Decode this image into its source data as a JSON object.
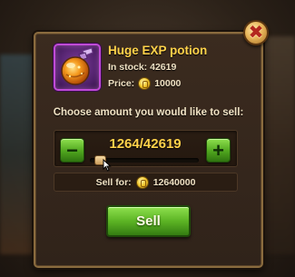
{
  "item": {
    "name": "Huge EXP potion",
    "stock_label": "In stock:",
    "stock_value": "42619",
    "price_label": "Price:",
    "price_value": "10000",
    "rarity_color": "#c04bd6",
    "icon": "exp-potion-icon"
  },
  "sell_dialog": {
    "prompt": "Choose amount you would like to sell:",
    "quantity_display": "1264/42619",
    "selected_amount": 1264,
    "max_amount": 42619,
    "sell_for_label": "Sell for:",
    "sell_for_value": "12640000",
    "sell_button_label": "Sell",
    "minus_label": "−",
    "plus_label": "+",
    "close_label": "✖"
  },
  "colors": {
    "title_gold": "#ffd24a",
    "button_green": "#5cb424",
    "panel_border": "#8a6b3e"
  }
}
